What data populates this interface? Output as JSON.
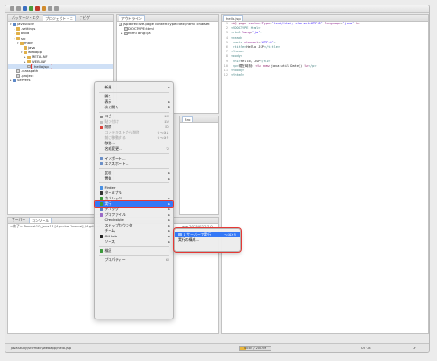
{
  "toolbar": {
    "buttons": [
      "new-icon",
      "save-icon",
      "debug-icon",
      "run-icon",
      "stop-icon",
      "search-icon"
    ]
  },
  "explorer": {
    "tabs": [
      "パッケージ・エク",
      "プロジェクト・エ",
      "ナビゲ"
    ],
    "tree": [
      {
        "label": "JavaStudy",
        "icon": "proj",
        "tw": "▾",
        "indent": 0
      },
      {
        "label": ".settings",
        "icon": "folder",
        "tw": "▸",
        "indent": 1
      },
      {
        "label": "build",
        "icon": "folder",
        "tw": "▸",
        "indent": 1
      },
      {
        "label": "src",
        "icon": "folder",
        "tw": "▾",
        "indent": 1
      },
      {
        "label": "main",
        "icon": "folder",
        "tw": "▾",
        "indent": 2
      },
      {
        "label": "java",
        "icon": "folder",
        "tw": "",
        "indent": 3
      },
      {
        "label": "webapp",
        "icon": "folder",
        "tw": "▾",
        "indent": 3
      },
      {
        "label": "META-INF",
        "icon": "folder",
        "tw": "▸",
        "indent": 4
      },
      {
        "label": "WEB-INF",
        "icon": "folder",
        "tw": "▸",
        "indent": 4
      },
      {
        "label": "hello.jsp",
        "icon": "file",
        "tw": "",
        "indent": 4
      },
      {
        "label": ".classpath",
        "icon": "file",
        "tw": "",
        "indent": 1
      },
      {
        "label": ".project",
        "icon": "file",
        "tw": "",
        "indent": 1
      },
      {
        "label": "Servers",
        "icon": "proj",
        "tw": "▸",
        "indent": 0
      }
    ]
  },
  "outline": {
    "tab": "アウトライン",
    "lines": [
      "jsp:directive.page contentType=text/html; charset",
      "DOCTYPE:html",
      "html lang=ja"
    ]
  },
  "editor": {
    "tab": "hello.jsp",
    "lines": [
      {
        "n": "1",
        "html": "<span class='kw'>&lt;%@ page</span> <span class='attr'>contentType</span>=<span class='str'>\"text/html; charset=UTF-8\"</span> <span class='attr'>language</span>=<span class='str'>\"java\"</span> <span class='kw'>%&gt;</span>"
      },
      {
        "n": "2",
        "html": "<span class='tag'>&lt;!DOCTYPE html&gt;</span>"
      },
      {
        "n": "3",
        "html": "<span class='tag'>&lt;html</span> <span class='attr'>lang</span>=<span class='str'>\"ja\"</span><span class='tag'>&gt;</span>"
      },
      {
        "n": "4",
        "html": "<span class='tag'>&lt;head&gt;</span>"
      },
      {
        "n": "5",
        "html": "    <span class='tag'>&lt;meta</span> <span class='attr'>charset</span>=<span class='str'>\"UTF-8\"</span><span class='tag'>&gt;</span>"
      },
      {
        "n": "6",
        "html": "    <span class='tag'>&lt;title&gt;</span><span class='txt'>Hello JSP</span><span class='tag'>&lt;/title&gt;</span>"
      },
      {
        "n": "7",
        "html": "<span class='tag'>&lt;/head&gt;</span>"
      },
      {
        "n": "8",
        "html": "<span class='tag'>&lt;body&gt;</span>"
      },
      {
        "n": "9",
        "html": "    <span class='tag'>&lt;h1&gt;</span><span class='txt'>Hello, JSP</span><span class='tag'>&lt;/h1&gt;</span>"
      },
      {
        "n": "10",
        "html": "    <span class='tag'>&lt;p&gt;</span><span class='txt'>現在時刻: </span><span class='kw'>&lt;%=</span> <span class='kw'>new</span> <span class='txt'>java.util.Date()</span> <span class='kw'>%&gt;</span><span class='tag'>&lt;/p&gt;</span>"
      },
      {
        "n": "11",
        "html": "<span class='tag'>&lt;/body&gt;</span>"
      },
      {
        "n": "12",
        "html": "<span class='tag'>&lt;/html&gt;</span>"
      }
    ]
  },
  "console": {
    "tabs": [
      "サーバー",
      "コンソール"
    ],
    "line": "<終了> Tomcat10_Java17 [Apache Tomcat] /Applicati",
    "line2": "ave 2025/02/27 0"
  },
  "mid_tab": "Bro",
  "menu": {
    "items": [
      {
        "label": "新規",
        "arrow": "▸",
        "type": "item"
      },
      {
        "type": "sep"
      },
      {
        "label": "開く",
        "type": "item"
      },
      {
        "label": "表示",
        "arrow": "▸",
        "type": "item"
      },
      {
        "label": "次で開く",
        "arrow": "▸",
        "type": "item"
      },
      {
        "type": "sep"
      },
      {
        "label": "コピー",
        "shortcut": "⌘C",
        "icon": "copy",
        "type": "item"
      },
      {
        "label": "貼り付け",
        "shortcut": "⌘V",
        "icon": "paste",
        "type": "item",
        "disabled": true
      },
      {
        "label": "削除",
        "shortcut": "⌦",
        "icon": "delete",
        "type": "item"
      },
      {
        "label": "コンテキストから削除",
        "shortcut": "⇧⌥⌘↓",
        "type": "item",
        "disabled": true
      },
      {
        "label": "前に移動する",
        "shortcut": "⇧⌥⌘↑",
        "type": "item",
        "disabled": true
      },
      {
        "label": "移動...",
        "type": "item"
      },
      {
        "label": "名前変更...",
        "shortcut": "F2",
        "type": "item"
      },
      {
        "type": "sep"
      },
      {
        "label": "インポート...",
        "icon": "import",
        "type": "item"
      },
      {
        "label": "エクスポート...",
        "icon": "export",
        "type": "item"
      },
      {
        "type": "sep"
      },
      {
        "label": "比較",
        "arrow": "▸",
        "type": "item"
      },
      {
        "label": "置換",
        "arrow": "▸",
        "type": "item"
      },
      {
        "type": "sep"
      },
      {
        "label": "Finder",
        "icon": "finder",
        "type": "item"
      },
      {
        "label": "ターミナル",
        "icon": "terminal",
        "type": "item"
      },
      {
        "label": "カバレッジ",
        "arrow": "▸",
        "icon": "coverage",
        "type": "item"
      },
      {
        "label": "実行",
        "arrow": "▸",
        "icon": "run",
        "type": "item",
        "active": true
      },
      {
        "label": "デバッグ",
        "arrow": "▸",
        "icon": "debug",
        "type": "item"
      },
      {
        "label": "プロファイル",
        "arrow": "▸",
        "icon": "profile",
        "type": "item"
      },
      {
        "label": "Checkstyle",
        "arrow": "▸",
        "type": "item"
      },
      {
        "label": "ステップカウンタ",
        "arrow": "▸",
        "type": "item"
      },
      {
        "label": "チーム",
        "arrow": "▸",
        "type": "item"
      },
      {
        "label": "GitHub",
        "arrow": "▸",
        "icon": "github",
        "type": "item"
      },
      {
        "label": "ソース",
        "arrow": "▸",
        "type": "item"
      },
      {
        "type": "sep"
      },
      {
        "label": "検証",
        "icon": "validate",
        "type": "item"
      },
      {
        "type": "sep"
      },
      {
        "label": "プロパティー",
        "shortcut": "⌘I",
        "type": "item"
      }
    ]
  },
  "submenu": {
    "items": [
      {
        "label": "1 サーバーで実行",
        "shortcut": "⌥⌘X R",
        "active": true
      },
      {
        "label": "実行の構成..."
      }
    ]
  },
  "status": {
    "path": "JavaStudy/src/main/webapp/hello.jsp",
    "heap": "405M / 2007M",
    "heap_fraction": 0.2,
    "encoding": "UTF-8",
    "lf": "LF"
  },
  "colors": {
    "accent": "#3478f6",
    "highlight": "#e53935"
  }
}
